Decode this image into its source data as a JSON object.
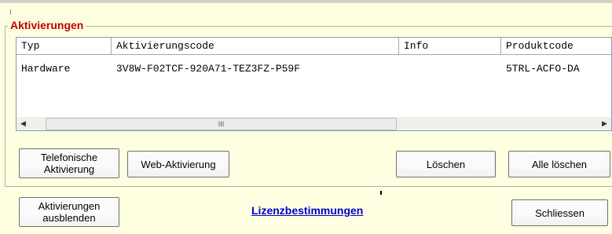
{
  "group": {
    "title": "Aktivierungen"
  },
  "table": {
    "columns": [
      "Typ",
      "Aktivierungscode",
      "Info",
      "Produktcode"
    ],
    "rows": [
      [
        "Hardware",
        "3V8W-F02TCF-920A71-TEZ3FZ-P59F",
        "",
        "5TRL-ACFO-DA"
      ]
    ]
  },
  "scrollbar": {
    "thumb_grip": "III"
  },
  "buttons": {
    "phone_activation": "Telefonische\nAktivierung",
    "web_activation": "Web-Aktivierung",
    "delete": "Löschen",
    "delete_all": "Alle löschen",
    "hide_activations": "Aktivierungen\nausblenden",
    "close": "Schliessen"
  },
  "license_link": "Lizenzbestimmungen",
  "colors": {
    "background": "#ffffe1",
    "group_title": "#c00000",
    "link": "#0000cc"
  }
}
